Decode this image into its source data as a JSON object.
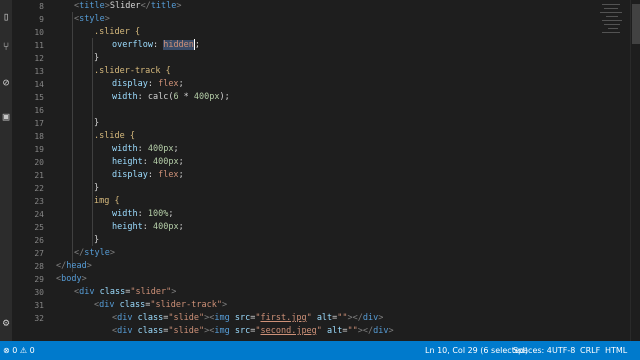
{
  "editor": {
    "line_numbers": [
      "8",
      "9",
      "10",
      "11",
      "12",
      "13",
      "14",
      "15",
      "16",
      "17",
      "18",
      "19",
      "20",
      "21",
      "22",
      "23",
      "24",
      "25",
      "26",
      "27",
      "28",
      "29",
      "30",
      "31",
      "32"
    ],
    "code": {
      "l8": {
        "open": "<",
        "tag": "title",
        "close": ">",
        "text": "Slider",
        "end_open": "</",
        "end_tag": "title",
        "end_close": ">"
      },
      "l9": {
        "open": "<",
        "tag": "style",
        "close": ">"
      },
      "l10": {
        "selector": ".slider {"
      },
      "l11": {
        "prop": "overflow",
        "colon": ": ",
        "value": "hidden",
        "semi": ";"
      },
      "l12": {
        "brace": "}"
      },
      "l13": {
        "selector": ".slider-track {"
      },
      "l14": {
        "prop": "display",
        "colon": ": ",
        "value": "flex",
        "semi": ";"
      },
      "l15": {
        "prop": "width",
        "colon": ": ",
        "fn": "calc(",
        "n1": "6",
        "op": " * ",
        "n2": "400px",
        "fn_end": ");"
      },
      "l17": {
        "brace": "}"
      },
      "l18": {
        "selector": ".slide {"
      },
      "l19": {
        "prop": "width",
        "colon": ": ",
        "value": "400px",
        "semi": ";"
      },
      "l20": {
        "prop": "height",
        "colon": ": ",
        "value": "400px",
        "semi": ";"
      },
      "l21": {
        "prop": "display",
        "colon": ": ",
        "value": "flex",
        "semi": ";"
      },
      "l22": {
        "brace": "}"
      },
      "l23": {
        "selector": "img {"
      },
      "l24": {
        "prop": "width",
        "colon": ": ",
        "value": "100%",
        "semi": ";"
      },
      "l25": {
        "prop": "height",
        "colon": ": ",
        "value": "400px",
        "semi": ";"
      },
      "l26": {
        "brace": "}"
      },
      "l27": {
        "open": "</",
        "tag": "style",
        "close": ">"
      },
      "l28": {
        "open": "</",
        "tag": "head",
        "close": ">"
      },
      "l29": {
        "open": "<",
        "tag": "body",
        "close": ">"
      },
      "l30": {
        "open": "<",
        "tag": "div",
        "attr": "class",
        "eq": "=",
        "q": "\"slider\"",
        "close": ">"
      },
      "l31": {
        "open": "<",
        "tag": "div",
        "attr": "class",
        "eq": "=",
        "q": "\"slider-track\"",
        "close": ">"
      },
      "l32": {
        "open": "<",
        "tag": "div",
        "attr": "class",
        "eq": "=",
        "q": "\"slide\"",
        "close": ">",
        "img_open": "<",
        "img_tag": "img",
        "src_attr": "src",
        "src_q1": "\"",
        "src_val": "first.jpg",
        "src_q2": "\"",
        "alt_attr": "alt",
        "alt_val": "\"\"",
        "img_close": ">",
        "end_open": "</",
        "end_tag": "div",
        "end_close": ">"
      },
      "l33": {
        "open": "<",
        "tag": "div",
        "attr": "class",
        "eq": "=",
        "q": "\"slide\"",
        "close": ">",
        "img_open": "<",
        "img_tag": "img",
        "src_attr": "src",
        "src_q1": "\"",
        "src_val": "second.jpeg",
        "src_q2": "\"",
        "alt_attr": "alt",
        "alt_val": "\"\"",
        "img_close": ">",
        "end_open": "</",
        "end_tag": "div",
        "end_close": ">"
      }
    }
  },
  "activity_bar": {
    "icons": [
      "files-icon",
      "search-icon",
      "source-control-icon",
      "debug-icon",
      "extensions-icon",
      "settings-icon"
    ]
  },
  "status_bar": {
    "errors": "0",
    "warnings": "0",
    "position": "Ln 10, Col 29 (6 selected)",
    "spaces": "Spaces: 4",
    "encoding": "UTF-8",
    "eol": "CRLF",
    "language": "HTML",
    "background": "#007acc"
  },
  "colors": {
    "editor_bg": "#1e1e1e",
    "tag": "#569cd6",
    "selector": "#d7ba7d",
    "property": "#9cdcfe",
    "string": "#ce9178",
    "number": "#b5cea8"
  }
}
